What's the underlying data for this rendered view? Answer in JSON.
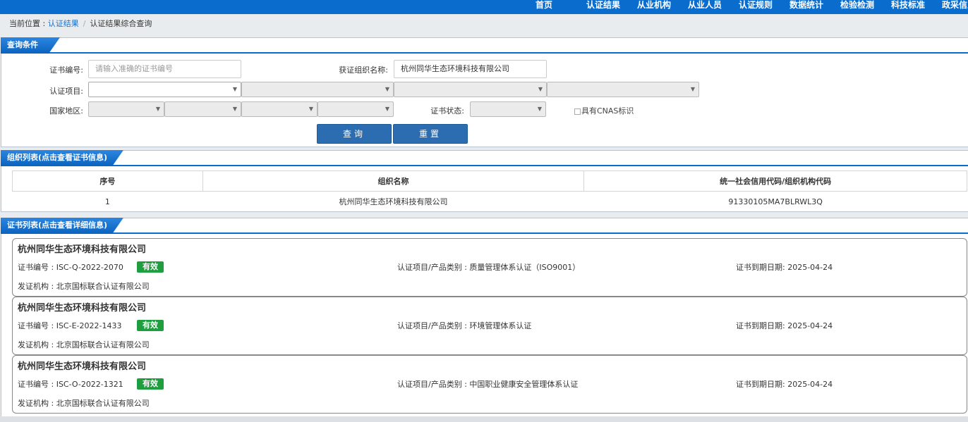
{
  "nav": [
    "首页",
    "认证结果",
    "从业机构",
    "从业人员",
    "认证规则",
    "数据统计",
    "检验检测",
    "科技标准",
    "政采信息"
  ],
  "breadcrumb": {
    "prefix": "当前位置 : ",
    "link": "认证结果",
    "separator": "/",
    "current": "认证结果综合查询"
  },
  "query": {
    "title": "查询条件",
    "cert_no_label": "证书编号:",
    "cert_no_placeholder": "请输入准确的证书编号",
    "org_name_label": "获证组织名称:",
    "org_name_value": "杭州同华生态环境科技有限公司",
    "project_label": "认证项目:",
    "region_label": "国家地区:",
    "status_label": "证书状态:",
    "cnas_label": "具有CNAS标识",
    "query_btn": "查询",
    "reset_btn": "重置"
  },
  "orgs": {
    "title": "组织列表(点击查看证书信息)",
    "headers": [
      "序号",
      "组织名称",
      "统一社会信用代码/组织机构代码"
    ],
    "rows": [
      [
        "1",
        "杭州同华生态环境科技有限公司",
        "91330105MA7BLRWL3Q"
      ]
    ]
  },
  "certs": {
    "title": "证书列表(点击查看详细信息)",
    "items": [
      {
        "org": "杭州同华生态环境科技有限公司",
        "cert_no": "证书编号 : ISC-Q-2022-2070",
        "status": "有效",
        "project": "认证项目/产品类别 : 质量管理体系认证（ISO9001）",
        "expire": "证书到期日期: 2025-04-24",
        "issuer": "发证机构 : 北京国标联合认证有限公司"
      },
      {
        "org": "杭州同华生态环境科技有限公司",
        "cert_no": "证书编号 : ISC-E-2022-1433",
        "status": "有效",
        "project": "认证项目/产品类别 : 环境管理体系认证",
        "expire": "证书到期日期: 2025-04-24",
        "issuer": "发证机构 : 北京国标联合认证有限公司"
      },
      {
        "org": "杭州同华生态环境科技有限公司",
        "cert_no": "证书编号 : ISC-O-2022-1321",
        "status": "有效",
        "project": "认证项目/产品类别 : 中国职业健康安全管理体系认证",
        "expire": "证书到期日期: 2025-04-24",
        "issuer": "发证机构 : 北京国标联合认证有限公司"
      }
    ]
  },
  "colors": {
    "brand_blue": "#0a6ccd",
    "button_blue": "#2b6db0",
    "valid_green": "#1e9e3f"
  }
}
